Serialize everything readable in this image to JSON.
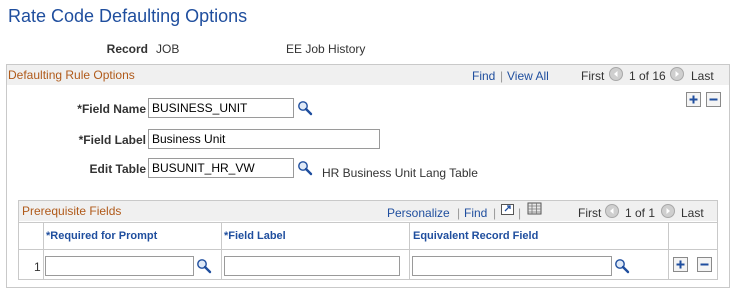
{
  "page": {
    "title": "Rate Code Defaulting Options"
  },
  "record": {
    "label": "Record",
    "value": "JOB",
    "description": "EE Job History"
  },
  "rule_section": {
    "title": "Defaulting Rule Options",
    "nav": {
      "find": "Find",
      "view_all": "View All",
      "first": "First",
      "counter": "1 of 16",
      "last": "Last"
    },
    "field_name": {
      "label": "*Field Name",
      "value": "BUSINESS_UNIT"
    },
    "field_label": {
      "label": "*Field Label",
      "value": "Business Unit"
    },
    "edit_table": {
      "label": "Edit Table",
      "value": "BUSUNIT_HR_VW",
      "description": "HR Business Unit Lang Table"
    }
  },
  "prereq": {
    "title": "Prerequisite Fields",
    "nav": {
      "personalize": "Personalize",
      "find": "Find",
      "first": "First",
      "counter": "1 of 1",
      "last": "Last"
    },
    "columns": [
      "*Required for Prompt",
      "*Field Label",
      "Equivalent Record Field"
    ],
    "rows": [
      {
        "num": "1",
        "required_for_prompt": "",
        "field_label": "",
        "equivalent_record_field": ""
      }
    ]
  },
  "icons": {
    "lookup": "magnifier-icon",
    "prev": "prev-arrow-icon",
    "next": "next-arrow-icon",
    "add": "plus-icon",
    "delete": "minus-icon",
    "zoom": "zoom-grid-icon",
    "download": "download-icon"
  }
}
